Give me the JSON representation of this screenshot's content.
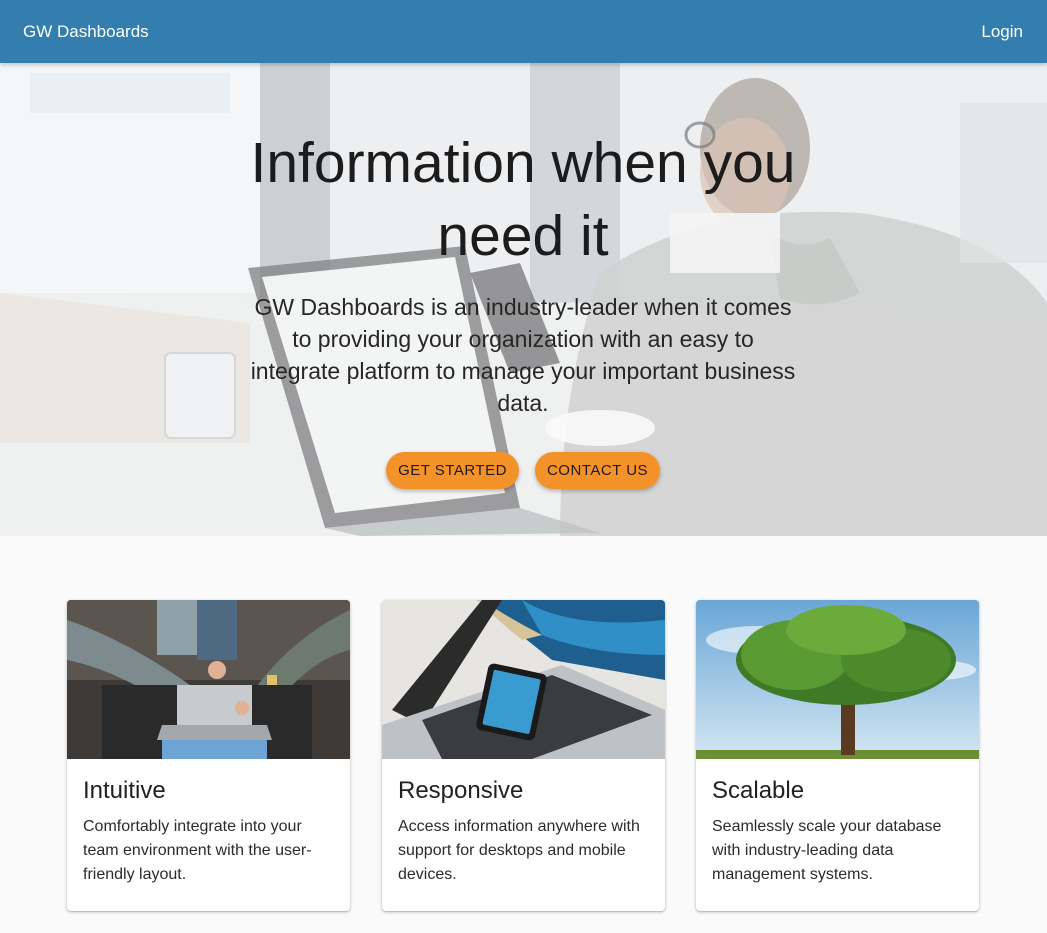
{
  "header": {
    "brand": "GW Dashboards",
    "login_label": "Login"
  },
  "hero": {
    "title": "Information when you need it",
    "text": "GW Dashboards is an industry-leader when it comes to providing your organization with an easy to integrate platform to manage your important business data.",
    "buttons": {
      "get_started": "GET STARTED",
      "contact_us": "CONTACT US"
    },
    "button_color": "#f4922a"
  },
  "cards": [
    {
      "title": "Intuitive",
      "text": "Comfortably integrate into your team environment with the user-friendly layout."
    },
    {
      "title": "Responsive",
      "text": "Access information anywhere with support for desktops and mobile devices."
    },
    {
      "title": "Scalable",
      "text": "Seamlessly scale your database with industry-leading data management systems."
    }
  ],
  "colors": {
    "appbar": "#337eaf",
    "accent": "#f4922a",
    "page_bg": "#fafafa"
  }
}
